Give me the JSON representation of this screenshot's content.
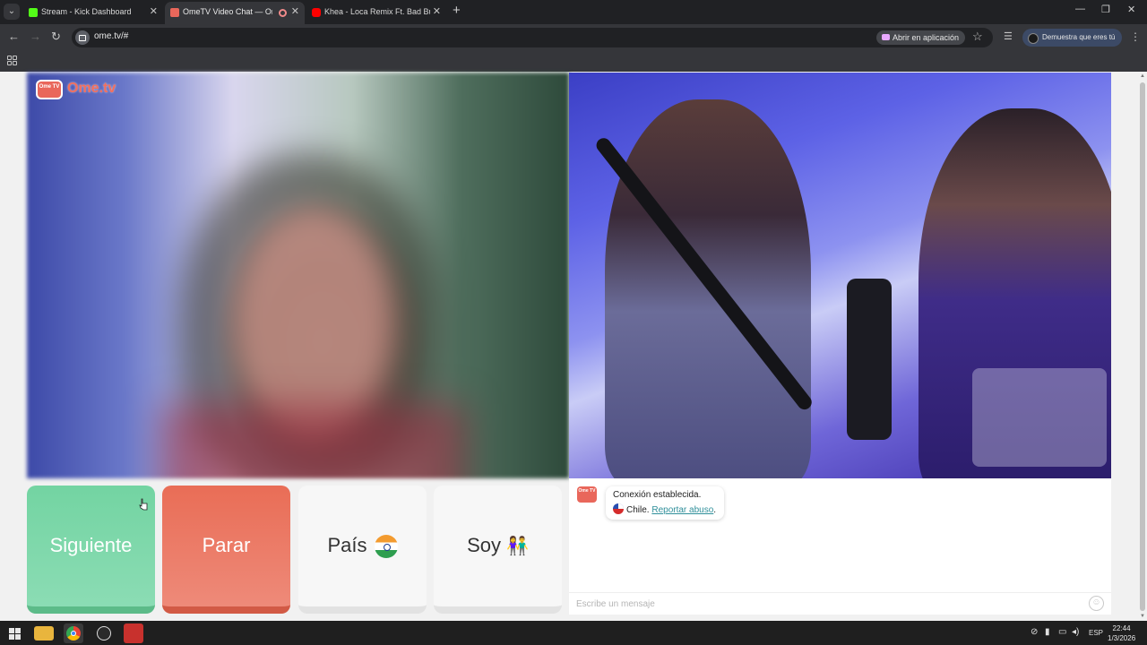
{
  "browser": {
    "tabs": [
      {
        "label": "Stream - Kick Dashboard",
        "favicon_color": "#53fc18",
        "active": false
      },
      {
        "label": "OmeTV Video Chat — Ome",
        "favicon_color": "#e9675b",
        "active": true
      },
      {
        "label": "Khea - Loca Remix Ft. Bad Bunny",
        "favicon_color": "#ff0000",
        "active": false
      }
    ],
    "new_tab": "+",
    "url": "ome.tv/#",
    "open_in_app": "Abrir en aplicación",
    "profile_label": "Demuestra que eres tú"
  },
  "site": {
    "logo_badge": "Ome TV",
    "logo_text": "Ome.tv"
  },
  "controls": {
    "next": "Siguiente",
    "stop": "Parar",
    "country": "País",
    "gender": "Soy"
  },
  "chat": {
    "logo_badge": "Ome TV",
    "status": "Conexión establecida.",
    "country": "Chile.",
    "report_link": "Reportar abuso",
    "report_suffix": ".",
    "input_placeholder": "Escribe un mensaje"
  },
  "taskbar": {
    "language": "ESP",
    "time": "22:44",
    "date": "1/3/2026"
  },
  "colors": {
    "next_button": "#73d4a2",
    "stop_button": "#e96d56",
    "brand": "#e9675b",
    "report_link": "#2f8f9a"
  }
}
